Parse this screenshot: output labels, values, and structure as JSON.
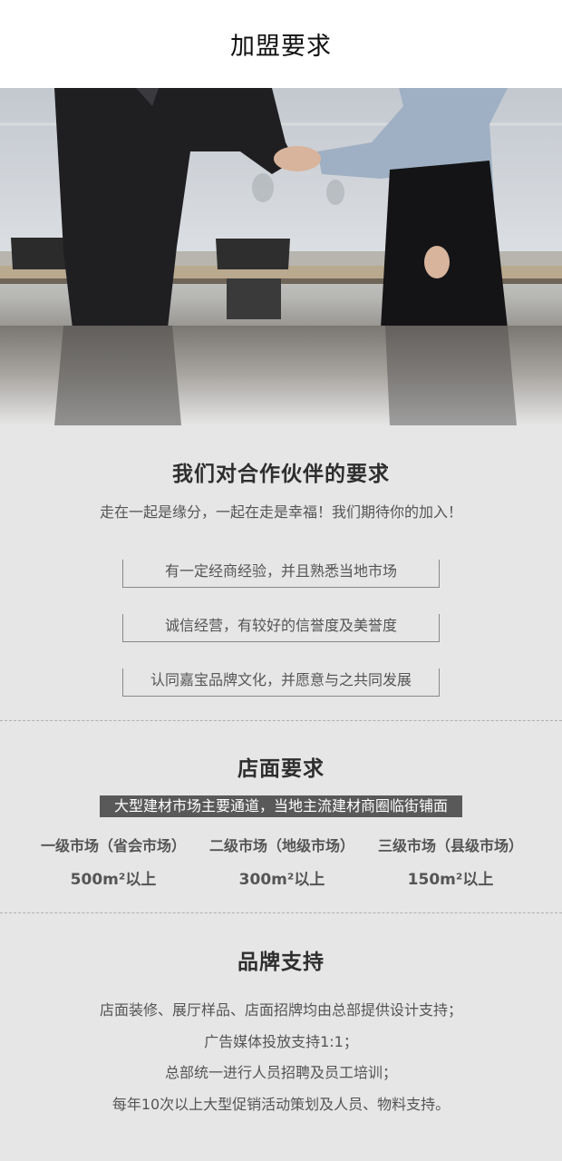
{
  "header": {
    "title": "加盟要求"
  },
  "hero": {
    "alt": "handshake-photo"
  },
  "partner_requirements": {
    "title": "我们对合作伙伴的要求",
    "subtitle": "走在一起是缘分，一起在走是幸福！我们期待你的加入！",
    "items": [
      "有一定经商经验，并且熟悉当地市场",
      "诚信经营，有较好的信誉度及美誉度",
      "认同嘉宝品牌文化，并愿意与之共同发展"
    ]
  },
  "store_requirements": {
    "title": "店面要求",
    "banner": "大型建材市场主要通道，当地主流建材商圈临街铺面",
    "tiers": [
      {
        "name": "一级市场（省会市场）",
        "area": "500m²以上"
      },
      {
        "name": "二级市场（地级市场）",
        "area": "300m²以上"
      },
      {
        "name": "三级市场（县级市场）",
        "area": "150m²以上"
      }
    ]
  },
  "brand_support": {
    "title": "品牌支持",
    "lines": [
      "店面装修、展厅样品、店面招牌均由总部提供设计支持；",
      "广告媒体投放支持1:1；",
      "总部统一进行人员招聘及员工培训；",
      "每年10次以上大型促销活动策划及人员、物料支持。"
    ]
  }
}
